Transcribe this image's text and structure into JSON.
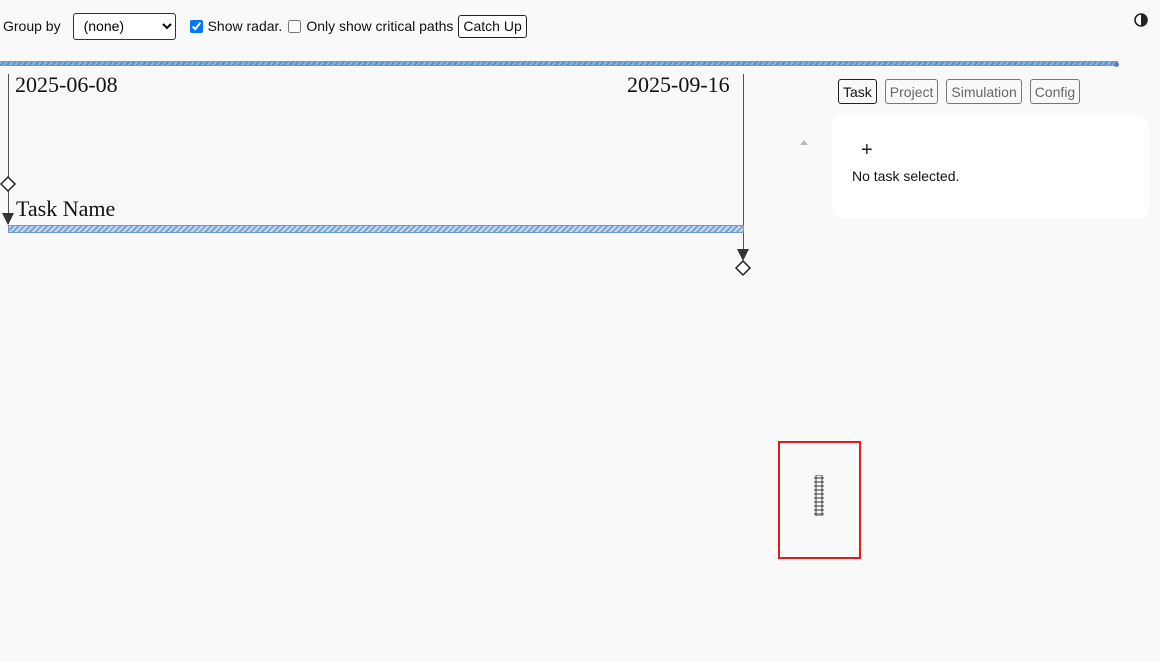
{
  "toolbar": {
    "group_by_label": "Group by",
    "group_by_value": "(none)",
    "show_radar_label": "Show radar.",
    "show_radar_checked": true,
    "critical_paths_label": "Only show critical paths",
    "critical_paths_checked": false,
    "catch_up_label": "Catch Up",
    "theme_icon": "contrast-icon"
  },
  "timeline": {
    "start_date": "2025-06-08",
    "end_date": "2025-09-16"
  },
  "task": {
    "name": "Task Name"
  },
  "side_panel": {
    "tabs": [
      "Task",
      "Project",
      "Simulation",
      "Config"
    ],
    "active_tab": "Task",
    "add_icon": "plus-icon",
    "empty_message": "No task selected."
  },
  "colors": {
    "task_bar": "#7aa3d3",
    "highlight": "#e31b1b"
  }
}
